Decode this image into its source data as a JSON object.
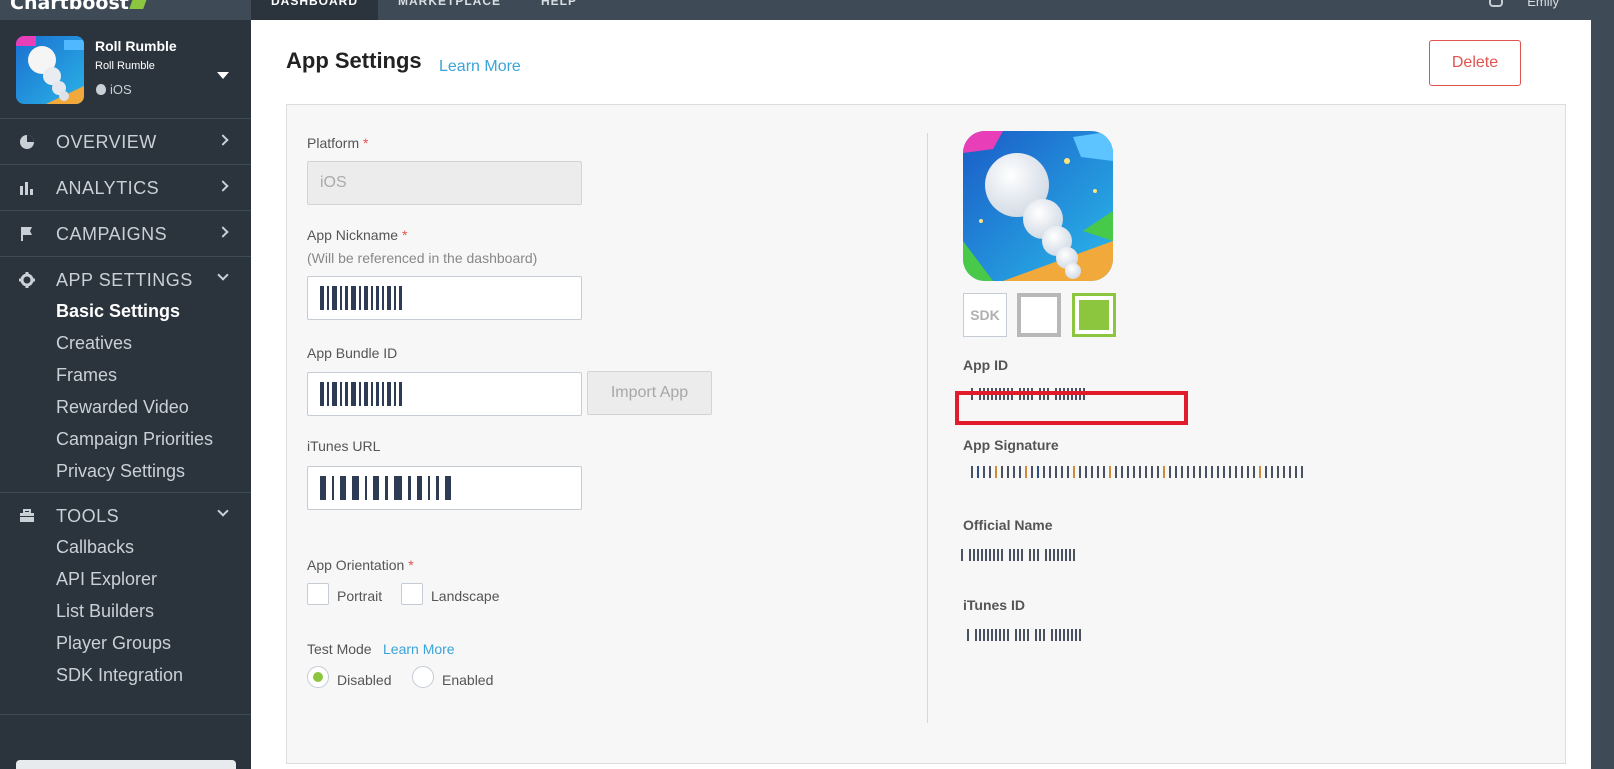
{
  "topbar": {
    "brand": "Chartboost",
    "tabs": [
      "DASHBOARD",
      "MARKETPLACE",
      "HELP"
    ],
    "user": "Emily"
  },
  "sidebar": {
    "app": {
      "name": "Roll Rumble",
      "subname": "Roll Rumble",
      "platform": "iOS"
    },
    "sections": [
      {
        "label": "OVERVIEW",
        "icon": "pie-chart-icon"
      },
      {
        "label": "ANALYTICS",
        "icon": "bar-chart-icon"
      },
      {
        "label": "CAMPAIGNS",
        "icon": "flag-icon"
      },
      {
        "label": "APP SETTINGS",
        "icon": "gear-icon"
      },
      {
        "label": "TOOLS",
        "icon": "toolbox-icon"
      }
    ],
    "app_settings_items": [
      "Basic Settings",
      "Creatives",
      "Frames",
      "Rewarded Video",
      "Campaign Priorities",
      "Privacy Settings"
    ],
    "tools_items": [
      "Callbacks",
      "API Explorer",
      "List Builders",
      "Player Groups",
      "SDK Integration"
    ]
  },
  "main": {
    "title": "App Settings",
    "learn_more": "Learn More",
    "delete": "Delete",
    "form": {
      "platform_label": "Platform",
      "platform_value": "iOS",
      "nickname_label": "App Nickname",
      "nickname_hint": "(Will be referenced in the dashboard)",
      "bundle_label": "App Bundle ID",
      "import_button": "Import App",
      "itunes_url_label": "iTunes URL",
      "orientation_label": "App Orientation",
      "orientation_options": [
        "Portrait",
        "Landscape"
      ],
      "test_mode_label": "Test Mode",
      "test_mode_learn_more": "Learn More",
      "test_mode_options": [
        "Disabled",
        "Enabled"
      ],
      "test_mode_selected": "Disabled",
      "required_mark": "*"
    },
    "details": {
      "sdk_badge": "SDK",
      "app_id_label": "App ID",
      "app_signature_label": "App Signature",
      "official_name_label": "Official Name",
      "itunes_id_label": "iTunes ID"
    }
  },
  "colors": {
    "accent_link": "#3aa3d9",
    "danger": "#e0534f",
    "brand_green": "#8cc63f",
    "sidebar_bg": "#2b343c",
    "highlight_red": "#e21b2a"
  }
}
